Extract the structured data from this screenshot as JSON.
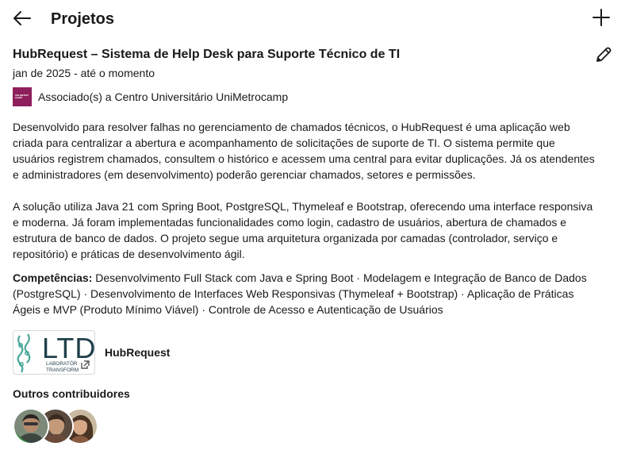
{
  "header": {
    "title": "Projetos"
  },
  "project": {
    "title": "HubRequest – Sistema de Help Desk para Suporte Técnico de TI",
    "date_range": "jan de 2025 - até o momento",
    "association": "Associado(s) a Centro Universitário UniMetrocamp",
    "association_logo_text": "UNI METRO CAMP",
    "description": [
      "Desenvolvido para resolver falhas no gerenciamento de chamados técnicos, o HubRequest é uma aplicação web criada para centralizar a abertura e acompanhamento de solicitações de suporte de TI. O sistema permite que usuários registrem chamados, consultem o histórico e acessem uma central para evitar duplicações. Já os atendentes e administradores (em desenvolvimento) poderão gerenciar chamados, setores e permissões.",
      "A solução utiliza Java 21 com Spring Boot, PostgreSQL, Thymeleaf e Bootstrap, oferecendo uma interface responsiva e moderna. Já foram implementadas funcionalidades como login, cadastro de usuários, abertura de chamados e estrutura de banco de dados. O projeto segue uma arquitetura organizada por camadas (controlador, serviço e repositório) e práticas de desenvolvimento ágil."
    ],
    "skills_label": "Competências:",
    "skills_text": " Desenvolvimento Full Stack com Java e Spring Boot · Modelagem e Integração de Banco de Dados (PostgreSQL) · Desenvolvimento de Interfaces Web Responsivas (Thymeleaf + Bootstrap) · Aplicação de Práticas Ágeis e MVP (Produto Mínimo Viável) · Controle de Acesso e Autenticação de Usuários"
  },
  "media": {
    "title": "HubRequest",
    "logo_main": "LTD",
    "logo_sub1": "LABORATÓR",
    "logo_sub2": "TRANSFORM"
  },
  "contributors": {
    "label": "Outros contribuidores"
  },
  "icons": {
    "back": "arrow-left-icon",
    "add": "plus-icon",
    "edit": "pencil-icon",
    "external": "external-link-icon"
  },
  "colors": {
    "association_logo": "#8e1f5c",
    "ltd_logo": "#1f3f4a",
    "ltd_accent": "#4aa89a"
  }
}
